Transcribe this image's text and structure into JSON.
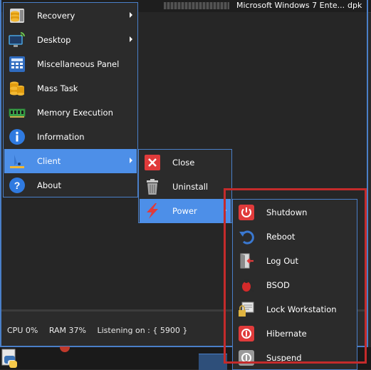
{
  "topbar": {
    "os_text": "Microsoft Windows 7 Ente...",
    "user": "dpk"
  },
  "main_menu": {
    "items": [
      {
        "label": "Recovery",
        "icon": "database-stack-icon",
        "has_submenu": true
      },
      {
        "label": "Desktop",
        "icon": "desktop-signal-icon",
        "has_submenu": true
      },
      {
        "label": "Miscellaneous Panel",
        "icon": "calculator-panel-icon",
        "has_submenu": false
      },
      {
        "label": "Mass Task",
        "icon": "database-coins-icon",
        "has_submenu": false
      },
      {
        "label": "Memory Execution",
        "icon": "memory-chip-icon",
        "has_submenu": false
      },
      {
        "label": "Information",
        "icon": "info-icon",
        "has_submenu": false
      },
      {
        "label": "Client",
        "icon": "client-user-icon",
        "has_submenu": true
      },
      {
        "label": "About",
        "icon": "question-icon",
        "has_submenu": false
      }
    ]
  },
  "client_menu": {
    "items": [
      {
        "label": "Close",
        "icon": "close-icon"
      },
      {
        "label": "Uninstall",
        "icon": "trash-icon"
      },
      {
        "label": "Power",
        "icon": "lightning-icon",
        "has_submenu": true
      }
    ]
  },
  "power_menu": {
    "items": [
      {
        "label": "Shutdown",
        "icon": "power-icon"
      },
      {
        "label": "Reboot",
        "icon": "reboot-icon"
      },
      {
        "label": "Log Out",
        "icon": "logout-door-icon"
      },
      {
        "label": "BSOD",
        "icon": "bug-icon"
      },
      {
        "label": "Lock Workstation",
        "icon": "lock-workstation-icon"
      },
      {
        "label": "Hibernate",
        "icon": "hibernate-icon"
      },
      {
        "label": "Suspend",
        "icon": "suspend-icon"
      }
    ]
  },
  "status": {
    "cpu": "CPU 0%",
    "ram": "RAM 37%",
    "listening": "Listening on : { 5900 }"
  },
  "colors": {
    "accent": "#4d8fe8",
    "border": "#4a7fc8",
    "highlight": "#c42b2b",
    "bg": "#2b2b2b"
  }
}
